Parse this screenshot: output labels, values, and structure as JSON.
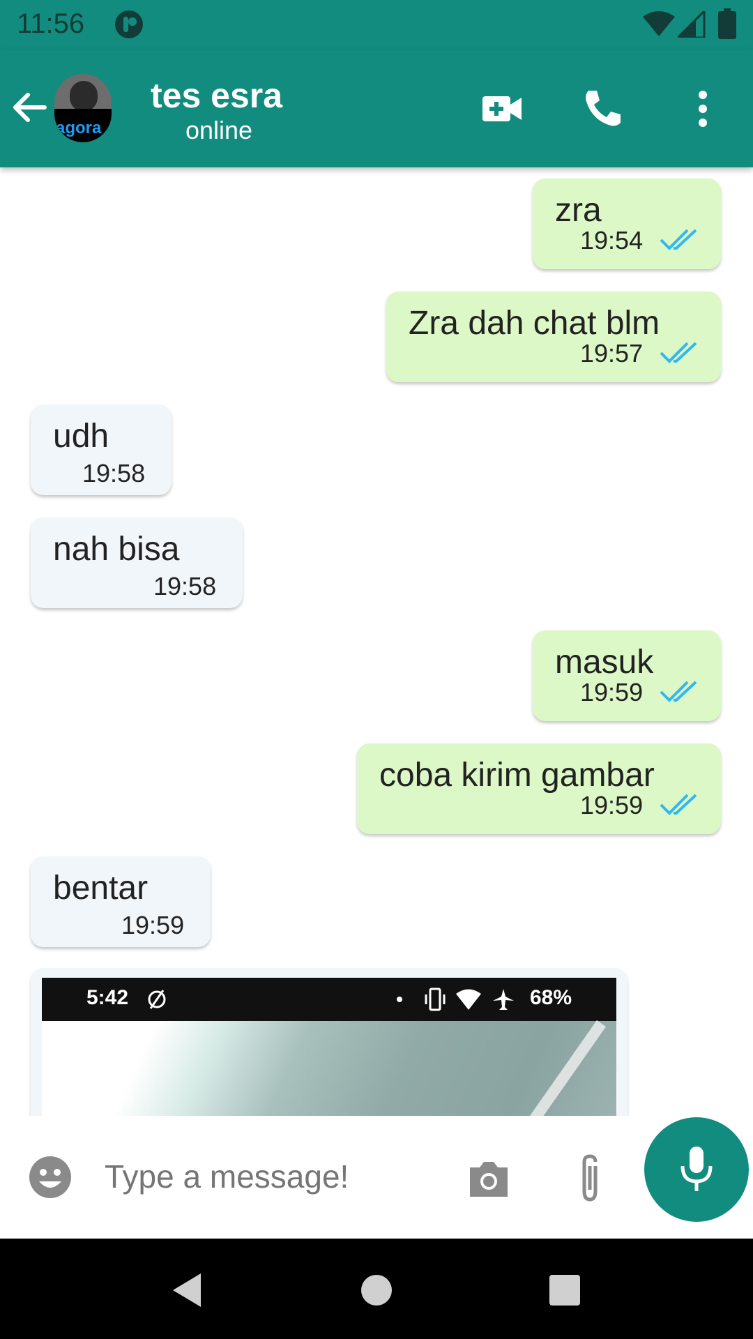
{
  "status_bar": {
    "time": "11:56",
    "icons": [
      "app-notification-icon",
      "wifi-icon",
      "signal-icon",
      "battery-icon"
    ]
  },
  "app_bar": {
    "contact_name": "tes esra",
    "status": "online",
    "avatar_logo_text": "agora",
    "actions": [
      "back-arrow-icon",
      "video-call-icon",
      "voice-call-icon",
      "more-vert-icon"
    ],
    "color": "#128C7E"
  },
  "messages": [
    {
      "dir": "out",
      "text": "zra",
      "time": "19:54",
      "read": true
    },
    {
      "dir": "out",
      "text": "Zra dah chat blm",
      "time": "19:57",
      "read": true
    },
    {
      "dir": "in",
      "text": "udh",
      "time": "19:58"
    },
    {
      "dir": "in",
      "text": "nah bisa",
      "time": "19:58"
    },
    {
      "dir": "out",
      "text": "masuk",
      "time": "19:59",
      "read": true
    },
    {
      "dir": "out",
      "text": "coba kirim gambar",
      "time": "19:59",
      "read": true
    },
    {
      "dir": "in",
      "text": "bentar",
      "time": "19:59"
    }
  ],
  "image_message": {
    "dir": "in",
    "embedded_status_time": "5:42",
    "embedded_battery": "68%"
  },
  "input_bar": {
    "placeholder": "Type a message!",
    "icons": [
      "emoji-icon",
      "camera-icon",
      "attach-icon",
      "mic-icon"
    ]
  },
  "colors": {
    "outgoing_bubble": "#DCF8C6",
    "incoming_bubble": "#F1F6FA",
    "read_tick": "#34B7F1"
  }
}
